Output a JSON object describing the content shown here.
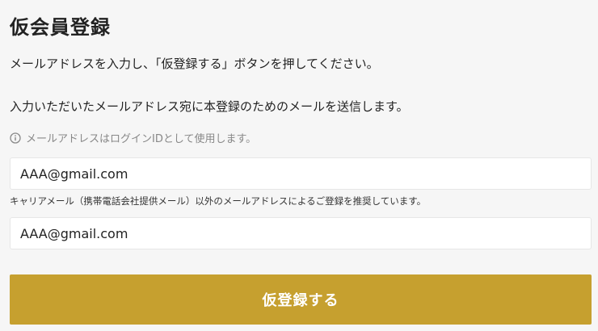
{
  "page": {
    "title": "仮会員登録"
  },
  "instructions": {
    "line1": "メールアドレスを入力し、「仮登録する」ボタンを押してください。",
    "line2": "入力いただいたメールアドレス宛に本登録のためのメールを送信します。"
  },
  "info": {
    "icon": "info-circle-icon",
    "text": "メールアドレスはログインIDとして使用します。"
  },
  "form": {
    "email": {
      "value": "AAA@gmail.com"
    },
    "carrier_note": "キャリアメール（携帯電話会社提供メール）以外のメールアドレスによるご登録を推奨しています。",
    "email_confirm": {
      "value": "AAA@gmail.com"
    },
    "submit_label": "仮登録する"
  },
  "colors": {
    "accent": "#c6a02f",
    "background": "#f6f6f6",
    "muted_text": "#888888"
  }
}
